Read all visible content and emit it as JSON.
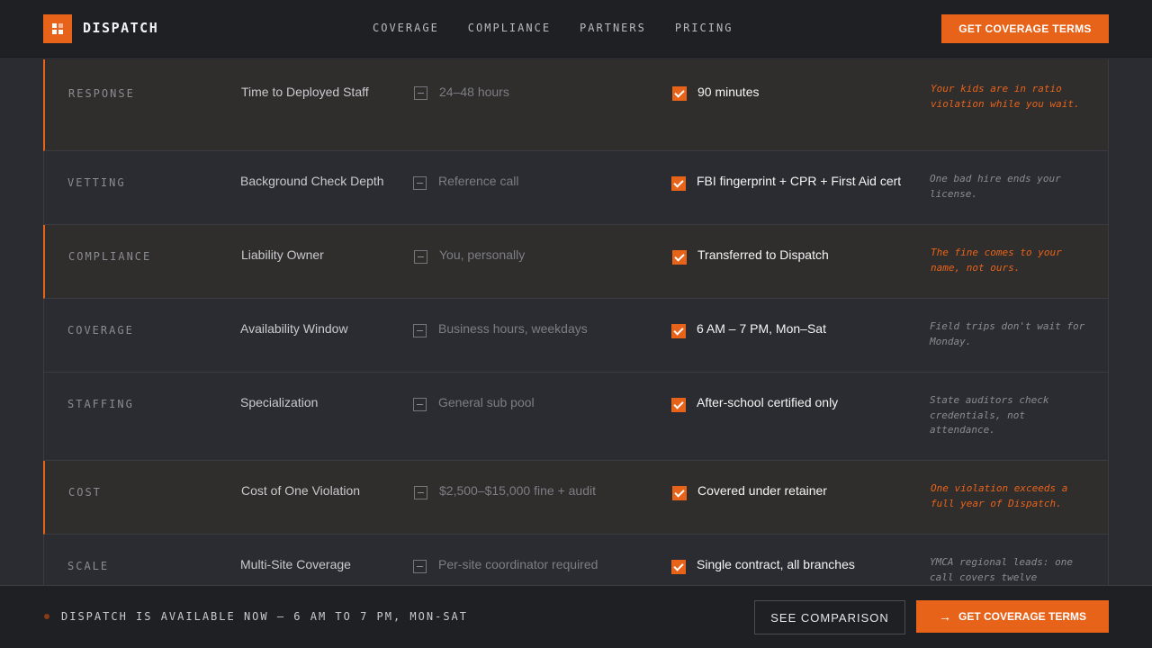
{
  "header": {
    "brand": "DISPATCH",
    "nav": [
      "COVERAGE",
      "COMPLIANCE",
      "PARTNERS",
      "PRICING"
    ],
    "cta": "GET COVERAGE TERMS"
  },
  "rows": [
    {
      "category": "RESPONSE",
      "metric": "Time to Deployed Staff",
      "old": "24–48 hours",
      "new": "90 minutes",
      "note": "Your kids are in ratio violation while you wait."
    },
    {
      "category": "VETTING",
      "metric": "Background Check Depth",
      "old": "Reference call",
      "new": "FBI fingerprint + CPR + First Aid cert",
      "note": "One bad hire ends your license."
    },
    {
      "category": "COMPLIANCE",
      "metric": "Liability Owner",
      "old": "You, personally",
      "new": "Transferred to Dispatch",
      "note": "The fine comes to your name, not ours."
    },
    {
      "category": "COVERAGE",
      "metric": "Availability Window",
      "old": "Business hours, weekdays",
      "new": "6 AM – 7 PM, Mon–Sat",
      "note": "Field trips don't wait for Monday."
    },
    {
      "category": "STAFFING",
      "metric": "Specialization",
      "old": "General sub pool",
      "new": "After-school certified only",
      "note": "State auditors check credentials, not attendance."
    },
    {
      "category": "COST",
      "metric": "Cost of One Violation",
      "old": "$2,500–$15,000 fine + audit",
      "new": "Covered under retainer",
      "note": "One violation exceeds a full year of Dispatch."
    },
    {
      "category": "SCALE",
      "metric": "Multi-Site Coverage",
      "old": "Per-site coordinator required",
      "new": "Single contract, all branches",
      "note": "YMCA regional leads: one call covers twelve"
    }
  ],
  "footer": {
    "status": "DISPATCH IS AVAILABLE NOW — 6 AM TO 7 PM, MON-SAT",
    "secondary_button": "SEE COMPARISON",
    "primary_button": "GET COVERAGE TERMS"
  },
  "colors": {
    "accent": "#e8631a",
    "background": "#2a2c31",
    "header": "#1f2024"
  },
  "icons": {
    "logo": "grid-logo-icon",
    "check": "checkbox-checked-icon",
    "minus": "checkbox-minus-icon",
    "arrow": "arrow-right-icon"
  }
}
